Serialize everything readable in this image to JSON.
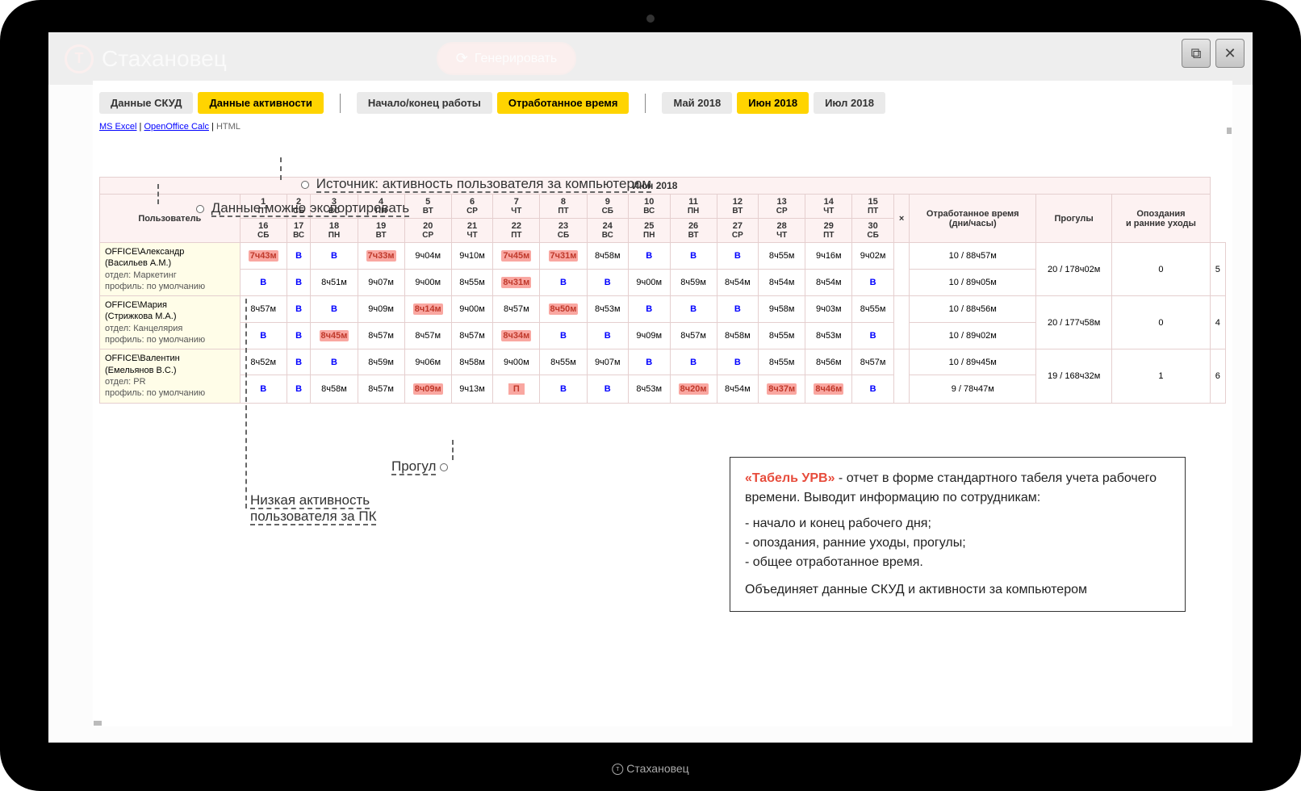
{
  "app": {
    "title": "Стахановец",
    "generate_btn": "Генерировать",
    "brand_footer": "Стахановец"
  },
  "window_controls": {
    "maximize": "⧉",
    "close": "✕"
  },
  "tabs": {
    "group1": [
      {
        "label": "Данные СКУД",
        "active": false
      },
      {
        "label": "Данные активности",
        "active": true
      }
    ],
    "group2": [
      {
        "label": "Начало/конец работы",
        "active": false
      },
      {
        "label": "Отработанное время",
        "active": true
      }
    ],
    "group3": [
      {
        "label": "Май 2018",
        "active": false
      },
      {
        "label": "Июн 2018",
        "active": true
      },
      {
        "label": "Июл 2018",
        "active": false
      }
    ]
  },
  "export": {
    "excel": "MS Excel",
    "ooo": "OpenOffice Calc",
    "html": "HTML"
  },
  "annotations": {
    "source": "Источник: активность пользователя за компьютером",
    "export": "Данные можно экспортировать",
    "progul": "Прогул",
    "low_activity": "Низкая активность пользователя за ПК"
  },
  "table": {
    "month": "Июн 2018",
    "user_header": "Пользователь",
    "worked_header": "Отработанное время (дни/часы)",
    "skips_header": "Прогулы",
    "late_header": "Опоздания и ранние уходы",
    "x_header": "×",
    "days_row1": [
      {
        "n": "1",
        "d": "ПТ"
      },
      {
        "n": "2",
        "d": "СБ"
      },
      {
        "n": "3",
        "d": "ВС"
      },
      {
        "n": "4",
        "d": "ПН"
      },
      {
        "n": "5",
        "d": "ВТ"
      },
      {
        "n": "6",
        "d": "СР"
      },
      {
        "n": "7",
        "d": "ЧТ"
      },
      {
        "n": "8",
        "d": "ПТ"
      },
      {
        "n": "9",
        "d": "СБ"
      },
      {
        "n": "10",
        "d": "ВС"
      },
      {
        "n": "11",
        "d": "ПН"
      },
      {
        "n": "12",
        "d": "ВТ"
      },
      {
        "n": "13",
        "d": "СР"
      },
      {
        "n": "14",
        "d": "ЧТ"
      },
      {
        "n": "15",
        "d": "ПТ"
      }
    ],
    "days_row2": [
      {
        "n": "16",
        "d": "СБ"
      },
      {
        "n": "17",
        "d": "ВС"
      },
      {
        "n": "18",
        "d": "ПН"
      },
      {
        "n": "19",
        "d": "ВТ"
      },
      {
        "n": "20",
        "d": "СР"
      },
      {
        "n": "21",
        "d": "ЧТ"
      },
      {
        "n": "22",
        "d": "ПТ"
      },
      {
        "n": "23",
        "d": "СБ"
      },
      {
        "n": "24",
        "d": "ВС"
      },
      {
        "n": "25",
        "d": "ПН"
      },
      {
        "n": "26",
        "d": "ВТ"
      },
      {
        "n": "27",
        "d": "СР"
      },
      {
        "n": "28",
        "d": "ЧТ"
      },
      {
        "n": "29",
        "d": "ПТ"
      },
      {
        "n": "30",
        "d": "СБ"
      }
    ],
    "users": [
      {
        "name": "OFFICE\\Александр",
        "full": "(Васильев А.М.)",
        "dept": "отдел: Маркетинг",
        "profile": "профиль: по умолчанию",
        "row1": [
          {
            "v": "7ч43м",
            "hl": true
          },
          {
            "v": "В",
            "b": true
          },
          {
            "v": "В",
            "b": true
          },
          {
            "v": "7ч33м",
            "hl": true
          },
          {
            "v": "9ч04м"
          },
          {
            "v": "9ч10м"
          },
          {
            "v": "7ч45м",
            "hl": true
          },
          {
            "v": "7ч31м",
            "hl": true
          },
          {
            "v": "8ч58м"
          },
          {
            "v": "В",
            "b": true
          },
          {
            "v": "В",
            "b": true
          },
          {
            "v": "В",
            "b": true
          },
          {
            "v": "8ч55м"
          },
          {
            "v": "9ч16м"
          },
          {
            "v": "9ч02м"
          }
        ],
        "row1_sum": "10 / 88ч57м",
        "row2": [
          {
            "v": "В",
            "b": true
          },
          {
            "v": "В",
            "b": true
          },
          {
            "v": "8ч51м"
          },
          {
            "v": "9ч07м"
          },
          {
            "v": "9ч00м"
          },
          {
            "v": "8ч55м"
          },
          {
            "v": "8ч31м",
            "hl": true
          },
          {
            "v": "В",
            "b": true
          },
          {
            "v": "В",
            "b": true
          },
          {
            "v": "9ч00м"
          },
          {
            "v": "8ч59м"
          },
          {
            "v": "8ч54м"
          },
          {
            "v": "8ч54м"
          },
          {
            "v": "8ч54м"
          },
          {
            "v": "В",
            "b": true
          }
        ],
        "row2_sum": "10 / 89ч05м",
        "total": "20 / 178ч02м",
        "skips": "0",
        "late": "5"
      },
      {
        "name": "OFFICE\\Мария",
        "full": "(Стрижкова М.А.)",
        "dept": "отдел: Канцелярия",
        "profile": "профиль: по умолчанию",
        "row1": [
          {
            "v": "8ч57м"
          },
          {
            "v": "В",
            "b": true
          },
          {
            "v": "В",
            "b": true
          },
          {
            "v": "9ч09м"
          },
          {
            "v": "8ч14м",
            "hl": true
          },
          {
            "v": "9ч00м"
          },
          {
            "v": "8ч57м"
          },
          {
            "v": "8ч50м",
            "hl": true
          },
          {
            "v": "8ч53м"
          },
          {
            "v": "В",
            "b": true
          },
          {
            "v": "В",
            "b": true
          },
          {
            "v": "В",
            "b": true
          },
          {
            "v": "9ч58м"
          },
          {
            "v": "9ч03м"
          },
          {
            "v": "8ч55м"
          }
        ],
        "row1_sum": "10 / 88ч56м",
        "row2": [
          {
            "v": "В",
            "b": true
          },
          {
            "v": "В",
            "b": true
          },
          {
            "v": "8ч45м",
            "hl": true
          },
          {
            "v": "8ч57м"
          },
          {
            "v": "8ч57м"
          },
          {
            "v": "8ч57м"
          },
          {
            "v": "8ч34м",
            "hl": true
          },
          {
            "v": "В",
            "b": true
          },
          {
            "v": "В",
            "b": true
          },
          {
            "v": "9ч09м"
          },
          {
            "v": "8ч57м"
          },
          {
            "v": "8ч58м"
          },
          {
            "v": "8ч55м"
          },
          {
            "v": "8ч53м"
          },
          {
            "v": "В",
            "b": true
          }
        ],
        "row2_sum": "10 / 89ч02м",
        "total": "20 / 177ч58м",
        "skips": "0",
        "late": "4"
      },
      {
        "name": "OFFICE\\Валентин",
        "full": "(Емельянов В.С.)",
        "dept": "отдел: PR",
        "profile": "профиль: по умолчанию",
        "row1": [
          {
            "v": "8ч52м"
          },
          {
            "v": "В",
            "b": true
          },
          {
            "v": "В",
            "b": true
          },
          {
            "v": "8ч59м"
          },
          {
            "v": "9ч06м"
          },
          {
            "v": "8ч58м"
          },
          {
            "v": "9ч00м"
          },
          {
            "v": "8ч55м"
          },
          {
            "v": "9ч07м"
          },
          {
            "v": "В",
            "b": true
          },
          {
            "v": "В",
            "b": true
          },
          {
            "v": "В",
            "b": true
          },
          {
            "v": "8ч55м"
          },
          {
            "v": "8ч56м"
          },
          {
            "v": "8ч57м"
          }
        ],
        "row1_sum": "10 / 89ч45м",
        "row2": [
          {
            "v": "В",
            "b": true
          },
          {
            "v": "В",
            "b": true
          },
          {
            "v": "8ч58м"
          },
          {
            "v": "8ч57м"
          },
          {
            "v": "8ч09м",
            "hl": true
          },
          {
            "v": "9ч13м"
          },
          {
            "v": "П",
            "p": true
          },
          {
            "v": "В",
            "b": true
          },
          {
            "v": "В",
            "b": true
          },
          {
            "v": "8ч53м"
          },
          {
            "v": "8ч20м",
            "hl": true
          },
          {
            "v": "8ч54м"
          },
          {
            "v": "8ч37м",
            "hl": true
          },
          {
            "v": "8ч46м",
            "hl": true
          },
          {
            "v": "В",
            "b": true
          }
        ],
        "row2_sum": "9 / 78ч47м",
        "total": "19 / 168ч32м",
        "skips": "1",
        "late": "6"
      }
    ]
  },
  "infobox": {
    "title": "«Табель УРВ»",
    "desc": " - отчет в форме стандартного табеля учета рабочего времени. Выводит информацию по сотрудникам:",
    "item1": "- начало и конец рабочего дня;",
    "item2": "- опоздания, ранние уходы, прогулы;",
    "item3": "- общее отработанное время.",
    "footer": "Объединяет данные СКУД и активности за компьютером"
  }
}
